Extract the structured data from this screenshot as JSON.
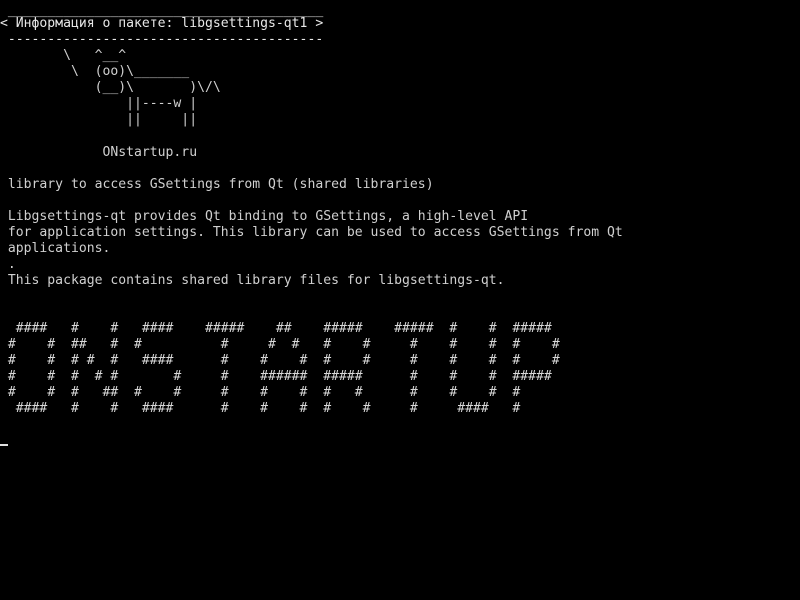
{
  "terminal": {
    "header": {
      "rule_top": " ________________________________________",
      "title": "< Информация о пакете: libgsettings-qt1 >",
      "rule_bottom": " ----------------------------------------"
    },
    "cow": [
      "        \\   ^__^",
      "         \\  (oo)\\_______",
      "            (__)\\       )\\/\\",
      "                ||----w |",
      "                ||     ||"
    ],
    "site": "             ONstartup.ru",
    "summary": " library to access GSettings from Qt (shared libraries)",
    "description": [
      " Libgsettings-qt provides Qt binding to GSettings, a high-level API",
      " for application settings. This library can be used to access GSettings from Qt",
      " applications.",
      " .",
      " This package contains shared library files for libgsettings-qt."
    ],
    "banner": [
      "  ####   #    #   ####    #####    ##    #####    #####  #    #  #####",
      " #    #  ##   #  #          #     #  #   #    #     #    #    #  #    #",
      " #    #  # #  #   ####      #    #    #  #    #     #    #    #  #    #",
      " #    #  #  # #       #     #    ######  #####      #    #    #  #####",
      " #    #  #   ##  #    #     #    #    #  #   #      #    #    #  #",
      "  ####   #    #   ####      #    #    #  #    #     #     ####   #"
    ]
  }
}
